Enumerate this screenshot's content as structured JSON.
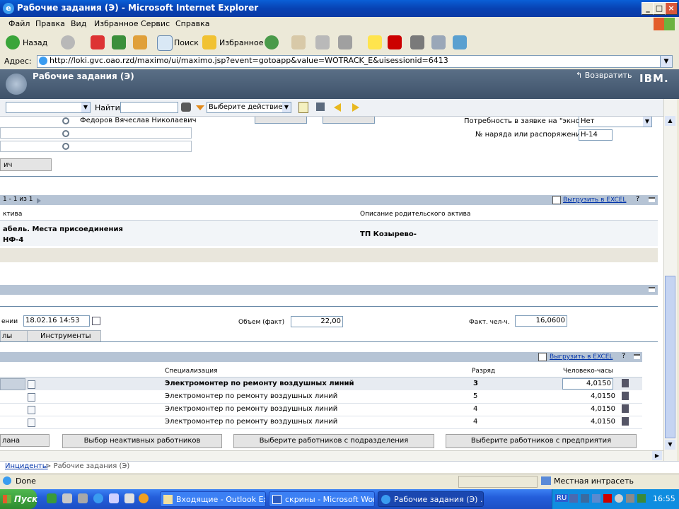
{
  "window": {
    "title": "Рабочие задания (Э) - Microsoft Internet Explorer",
    "minimize": "_",
    "maximize": "□",
    "close": "×"
  },
  "menu": [
    "Файл",
    "Правка",
    "Вид",
    "Избранное",
    "Сервис",
    "Справка"
  ],
  "toolbar": {
    "back": "Назад",
    "search": "Поиск",
    "favorites": "Избранное"
  },
  "address": {
    "label": "Адрес:",
    "url": "http://loki.gvc.oao.rzd/maximo/ui/maximo.jsp?event=gotoapp&value=WOTRACK_E&uisessionid=6413"
  },
  "app": {
    "title": "Рабочие задания (Э)",
    "return_label": "Возвратить",
    "logo": "IBM.",
    "find_label": "Найти:",
    "action_select": "Выберите действие"
  },
  "top_form": {
    "person_value": "Федоров Вячеслав Николаевич",
    "left_button_partial": "ич",
    "need_label": "Потребность в заявке на \"экно\"",
    "need_value": "Нет",
    "order_label": "№ наряда или распоряжений",
    "order_value": "Н-14"
  },
  "assets": {
    "pager": "1 - 1 из 1",
    "export_label": "Выгрузить в EXCEL",
    "help": "?",
    "col1_header": "ктива",
    "col2_header": "Описание родительского актива",
    "row_name_line1": "абель. Места присоединения",
    "row_name_line2": "НФ-4",
    "row_parent": "ТП Козырево-"
  },
  "actuals": {
    "date_label_partial": "ении",
    "date_value": "18.02.16 14:53",
    "volume_label": "Объем (факт)",
    "volume_value": "22,00",
    "manhours_label": "Факт. чел-ч.",
    "manhours_value": "16,0600",
    "tab1": "лы",
    "tab2": "Инструменты"
  },
  "labor": {
    "export_label": "Выгрузить в EXCEL",
    "help": "?",
    "headers": {
      "spec": "Специализация",
      "rank": "Разряд",
      "hours": "Человеко-часы"
    },
    "rows": [
      {
        "spec": "Электромонтер по ремонту воздушных линий",
        "rank": "3",
        "hours": "4,0150"
      },
      {
        "spec": "Электромонтер по ремонту воздушных линий",
        "rank": "5",
        "hours": "4,0150"
      },
      {
        "spec": "Электромонтер по ремонту воздушных линий",
        "rank": "4",
        "hours": "4,0150"
      },
      {
        "spec": "Электромонтер по ремонту воздушных линий",
        "rank": "4",
        "hours": "4,0150"
      }
    ],
    "buttons": {
      "b1": "лана",
      "b2": "Выбор неактивных работников",
      "b3": "Выберите работников с подразделения",
      "b4": "Выберите работников с предприятия"
    }
  },
  "breadcrumb": {
    "link": "Инциденты",
    "sep": " > ",
    "current": "Рабочие задания (Э)"
  },
  "status": {
    "text": "Done",
    "zone": "Местная интрасеть"
  },
  "taskbar": {
    "start": "Пуск",
    "tasks": [
      "Входящие - Outlook Exp...",
      "скрины - Microsoft Word",
      "Рабочие задания (Э) ..."
    ],
    "lang": "RU",
    "clock": "16:55"
  }
}
